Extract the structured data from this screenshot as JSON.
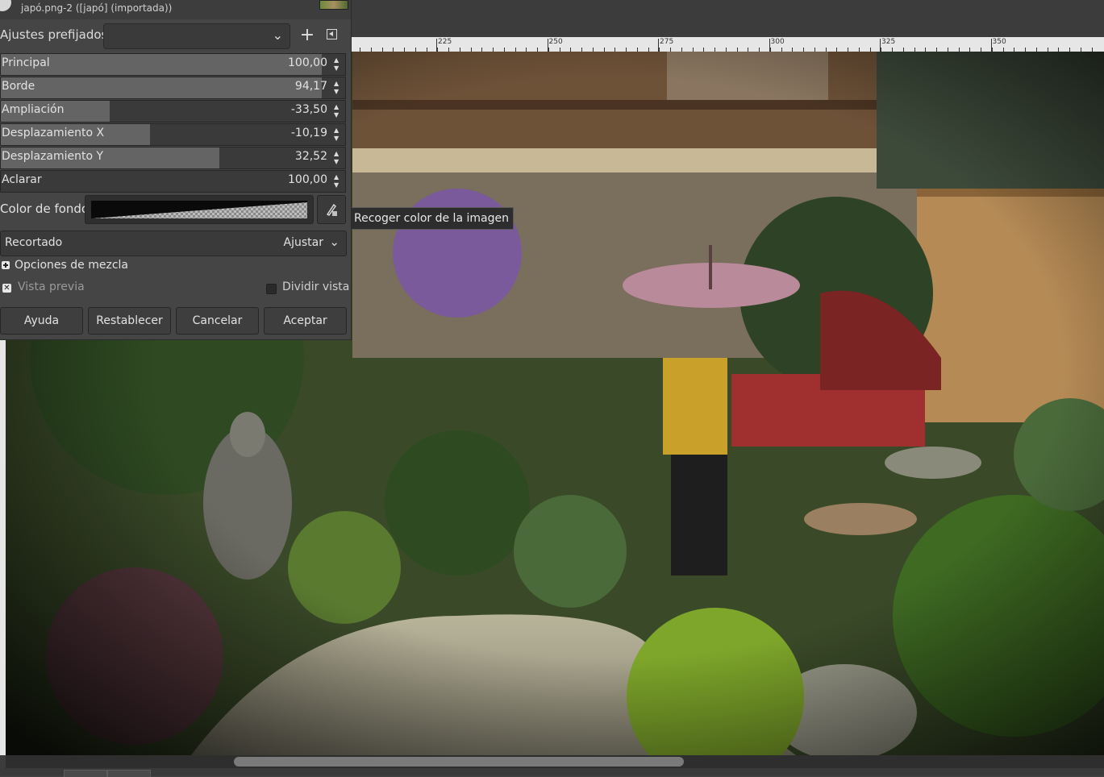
{
  "dialog": {
    "image_name": "japó.png-2 ([japó] (importada))",
    "presets": {
      "label": "Ajustes prefijados:",
      "value": ""
    },
    "sliders": [
      {
        "label": "Principal",
        "value": "100,00",
        "fill_fraction": 0.97
      },
      {
        "label": "Borde",
        "value": "94,17",
        "fill_fraction": 0.97
      },
      {
        "label": "Ampliación",
        "value": "-33,50",
        "fill_fraction": 0.33
      },
      {
        "label": "Desplazamiento X",
        "value": "-10,19",
        "fill_fraction": 0.45
      },
      {
        "label": "Desplazamiento Y",
        "value": "32,52",
        "fill_fraction": 0.66
      },
      {
        "label": "Aclarar",
        "value": "100,00",
        "fill_fraction": 0.0
      }
    ],
    "background_color": {
      "label": "Color de fondo",
      "gradient_from": "#000000"
    },
    "cropping": {
      "label": "Recortado",
      "value": "Ajustar"
    },
    "blend_options": {
      "label": "Opciones de mezcla"
    },
    "preview": {
      "label": "Vista previa",
      "checked": true
    },
    "split_view": {
      "label": "Dividir vista",
      "checked": false
    },
    "buttons": {
      "help": "Ayuda",
      "reset": "Restablecer",
      "cancel": "Cancelar",
      "ok": "Aceptar"
    }
  },
  "tooltip": "Recoger color de la imagen",
  "ruler": {
    "labels": [
      "225",
      "250",
      "275",
      "300",
      "325",
      "350"
    ]
  },
  "icons": {
    "add": "plus-icon",
    "preset_menu": "menu-arrow-icon",
    "picker": "color-picker-icon",
    "chevron": "chevron-down-icon"
  },
  "colors": {
    "panel": "#454545",
    "slider_fill": "#646464",
    "slider_bg": "#3a3a3a"
  }
}
